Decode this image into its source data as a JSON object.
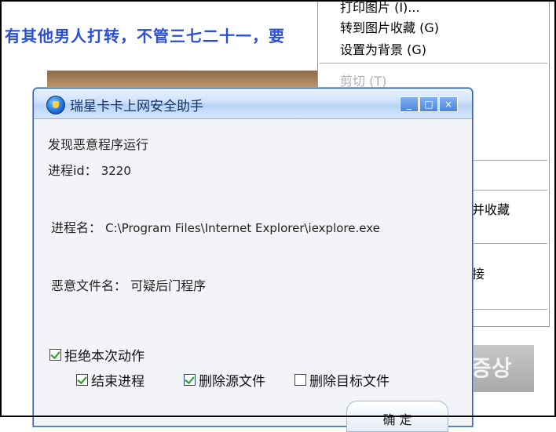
{
  "background": {
    "headline": "有其他男人打转，不管三七二十一，要",
    "korean_fragment": "증상"
  },
  "context_menu": {
    "items": [
      {
        "label": "打印图片 (I)...",
        "disabled": false
      },
      {
        "label": "转到图片收藏 (G)",
        "disabled": false
      },
      {
        "label": "设置为背景 (G)",
        "disabled": false
      },
      {
        "label": "剪切 (T)",
        "disabled": true
      },
      {
        "label": "并收藏",
        "disabled": false
      },
      {
        "label": "接",
        "disabled": false
      }
    ]
  },
  "dialog": {
    "title": "瑞星卡卡上网安全助手",
    "buttons": {
      "minimize": "_",
      "maximize": "□",
      "close": "×"
    },
    "heading": "发现恶意程序运行",
    "pid_label": "进程id：",
    "pid_value": "3220",
    "process_label": "进程名：",
    "process_value": "C:\\Program Files\\Internet Explorer\\iexplore.exe",
    "file_label": "恶意文件名：",
    "file_value": "可疑后门程序",
    "block_action": {
      "label": "拒绝本次动作",
      "checked": true
    },
    "options": [
      {
        "label": "结束进程",
        "checked": true
      },
      {
        "label": "删除源文件",
        "checked": true
      },
      {
        "label": "删除目标文件",
        "checked": false
      }
    ],
    "ok_label": "确 定"
  }
}
